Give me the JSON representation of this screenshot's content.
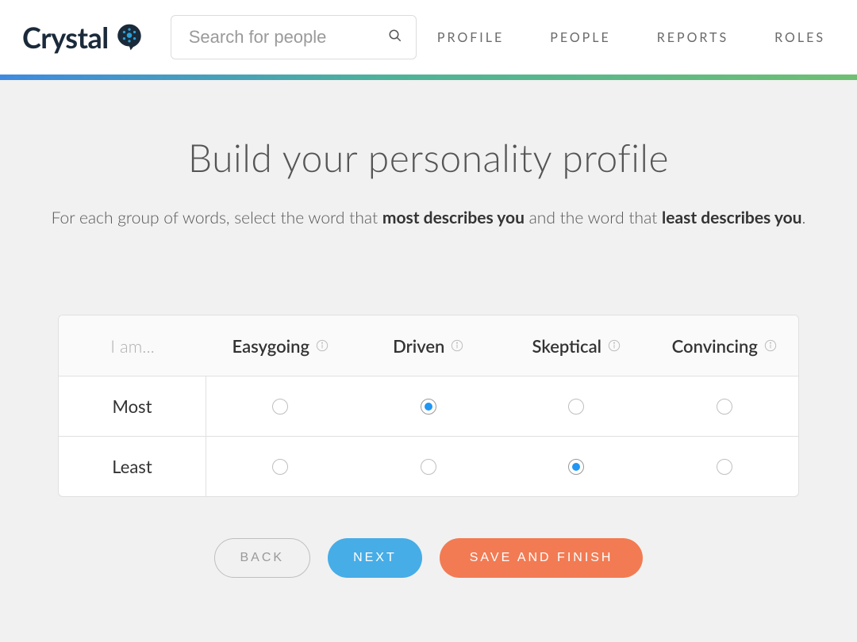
{
  "brand": {
    "name": "Crystal"
  },
  "search": {
    "placeholder": "Search for people"
  },
  "nav": {
    "profile": "PROFILE",
    "people": "PEOPLE",
    "reports": "REPORTS",
    "roles": "ROLES"
  },
  "page": {
    "title": "Build your personality profile",
    "subtitle_pre": "For each group of words, select the word that ",
    "subtitle_b1": "most describes you",
    "subtitle_mid": " and the word that ",
    "subtitle_b2": "least describes you",
    "subtitle_post": "."
  },
  "table": {
    "corner": "I am...",
    "traits": [
      "Easygoing",
      "Driven",
      "Skeptical",
      "Convincing"
    ],
    "rows": [
      {
        "label": "Most",
        "selected_index": 1
      },
      {
        "label": "Least",
        "selected_index": 2
      }
    ]
  },
  "buttons": {
    "back": "BACK",
    "next": "NEXT",
    "save": "SAVE AND FINISH"
  },
  "colors": {
    "accent_blue": "#46ade7",
    "accent_orange": "#f27b53",
    "radio_fill": "#2196f3"
  }
}
